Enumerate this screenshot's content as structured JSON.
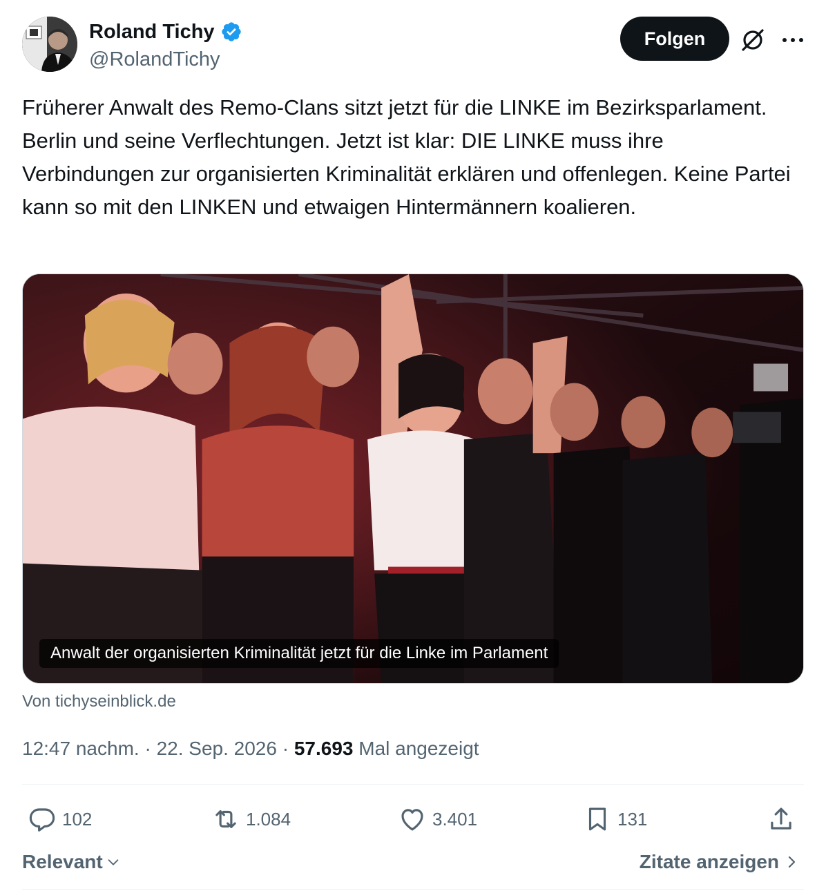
{
  "author": {
    "display_name": "Roland Tichy",
    "handle": "@RolandTichy",
    "verified_color": "#1d9bf0"
  },
  "header": {
    "follow_label": "Folgen"
  },
  "tweet": {
    "text": "Früherer Anwalt des Remo-Clans sitzt jetzt für die LINKE im Bezirksparlament. Berlin und seine Verflechtungen. Jetzt ist klar: DIE LINKE muss ihre Verbindungen zur organisierten Kriminalität erklären und offenlegen. Keine Partei kann so mit den LINKEN und etwaigen Hintermännern koalieren."
  },
  "card": {
    "caption": "Anwalt der organisierten Kriminalität jetzt für die Linke im Parlament",
    "source": "Von tichyseinblick.de"
  },
  "meta": {
    "time": "12:47 nachm.",
    "separator": "·",
    "date": "22. Sep. 2026",
    "views_count": "57.693",
    "views_label": "Mal angezeigt"
  },
  "actions": {
    "replies": "102",
    "reposts": "1.084",
    "likes": "3.401",
    "bookmarks": "131"
  },
  "footer": {
    "sort_label": "Relevant",
    "quotes_label": "Zitate anzeigen"
  },
  "icons": [
    "verified-badge-icon",
    "grok-icon",
    "more-icon",
    "reply-icon",
    "repost-icon",
    "like-icon",
    "bookmark-icon",
    "share-icon",
    "chevron-down-icon",
    "chevron-right-icon"
  ]
}
